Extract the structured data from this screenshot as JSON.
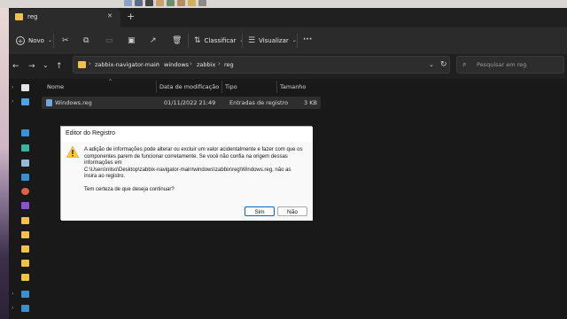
{
  "tab": {
    "title": "reg",
    "close_glyph": "✕",
    "new_glyph": "+"
  },
  "toolbar": {
    "new_label": "Novo",
    "sort_label": "Classificar",
    "view_label": "Visualizar",
    "more_glyph": "···"
  },
  "nav": {
    "back": "←",
    "forward": "→",
    "down": "⌄",
    "up": "↑",
    "refresh": "↻"
  },
  "breadcrumb": {
    "chevron": "›",
    "items": [
      "zabbix-navigator-main",
      "windows",
      "zabbix",
      "reg"
    ]
  },
  "search": {
    "placeholder": "Pesquisar em reg"
  },
  "columns": {
    "name": "Nome",
    "date": "Data de modificação",
    "type": "Tipo",
    "size": "Tamanho"
  },
  "files": [
    {
      "name": "Windows.reg",
      "date": "01/11/2022 21:49",
      "type": "Entradas de registro",
      "size": "3 KB"
    }
  ],
  "dialog": {
    "title": "Editor do Registro",
    "line1": "A adição de informações pode alterar ou excluir um valor acidentalmente e fazer com que os",
    "line2": "componentes parem de funcionar corretamente. Se você não confia na origem dessas",
    "line3": "informações em",
    "line4": "C:\\Users\\nilso\\Desktop\\zabbix-navigator-main\\windows\\zabbix\\reg\\Windows.reg, não as",
    "line5": "insira ao registro.",
    "question": "Tem certeza de que deseja continuar?",
    "yes_label": "Sim",
    "no_label": "Não"
  },
  "colors": {
    "accent": "#ffc83d",
    "folder": "#f0c24a",
    "selection": "#2e2e2e",
    "dialog_button_focus": "#0067c0"
  }
}
